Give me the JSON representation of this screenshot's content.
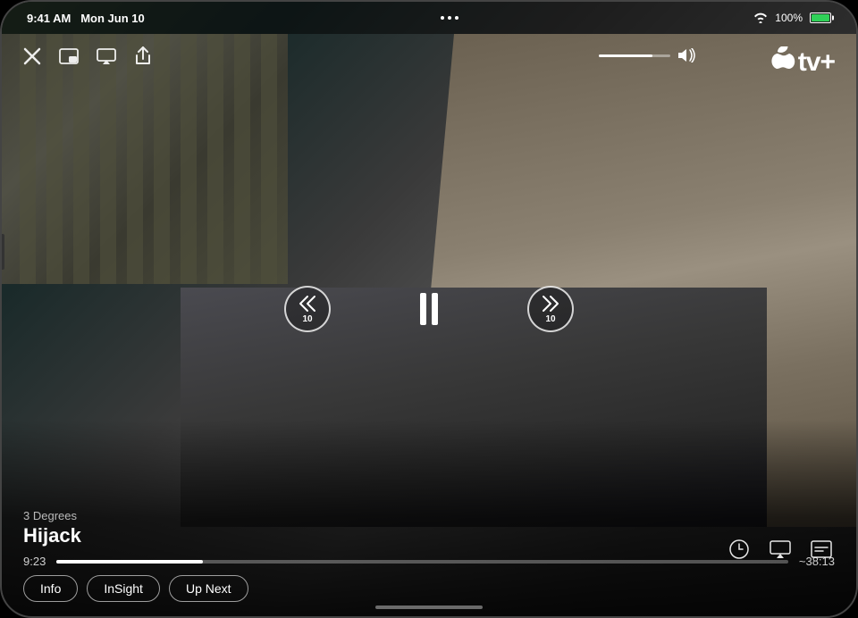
{
  "status_bar": {
    "time": "9:41 AM",
    "date": "Mon Jun 10",
    "signal_dots": 3,
    "wifi": "WiFi",
    "battery_percent": "100%"
  },
  "video": {
    "show_name": "3 Degrees",
    "episode_title": "Hijack",
    "time_elapsed": "9:23",
    "time_remaining": "~38:13",
    "progress_percent": 20
  },
  "controls": {
    "close_label": "✕",
    "picture_in_picture_label": "PiP",
    "airplay_label": "AirPlay",
    "share_label": "Share",
    "rewind_label": "10",
    "forward_label": "10",
    "pause_label": "Pause",
    "volume_icon": "🔊",
    "speed_icon": "speed",
    "airplay_bottom_icon": "airplay",
    "subtitles_icon": "subtitles"
  },
  "apple_tv": {
    "logo_text": "tv+",
    "logo_apple": ""
  },
  "action_buttons": [
    {
      "id": "info",
      "label": "Info"
    },
    {
      "id": "insight",
      "label": "InSight"
    },
    {
      "id": "up-next",
      "label": "Up Next"
    }
  ]
}
